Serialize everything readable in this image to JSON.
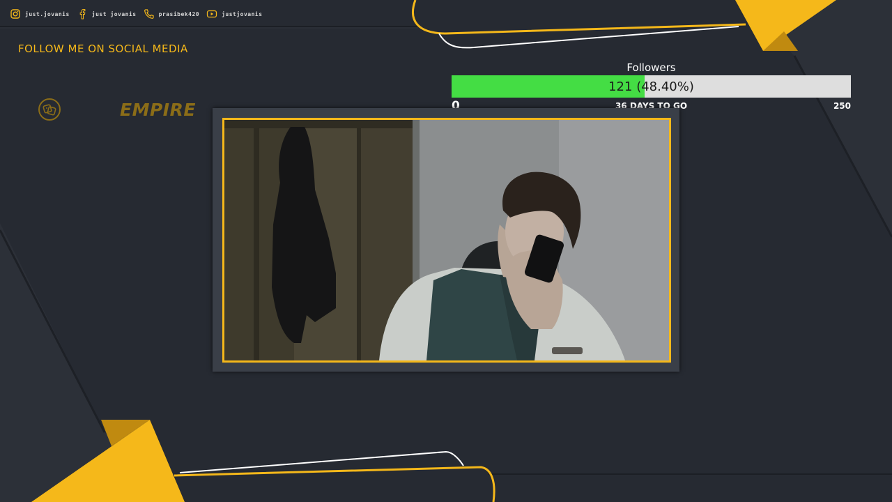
{
  "social": [
    {
      "icon": "instagram-icon",
      "label": "just.jovanis"
    },
    {
      "icon": "facebook-icon",
      "label": "just jovanis"
    },
    {
      "icon": "phone-icon",
      "label": "prasibek420"
    },
    {
      "icon": "youtube-icon",
      "label": "justjovanis"
    }
  ],
  "follow_text": "FOLLOW ME ON SOCIAL MEDIA",
  "logo": {
    "text": "EMPIRE",
    "icon": "dice-logo-icon"
  },
  "goal": {
    "title": "Followers",
    "value_text": "121 (48.40%)",
    "current": 121,
    "target": 250,
    "percent": 48.4,
    "start_label": "0",
    "end_label": "250",
    "days_text": "36 DAYS TO GO"
  },
  "colors": {
    "background": "#262a32",
    "accent": "#f5b81a",
    "progress_fill": "#44dd44",
    "progress_track": "#dedede"
  },
  "webcam": {
    "icon": "webcam-feed"
  }
}
